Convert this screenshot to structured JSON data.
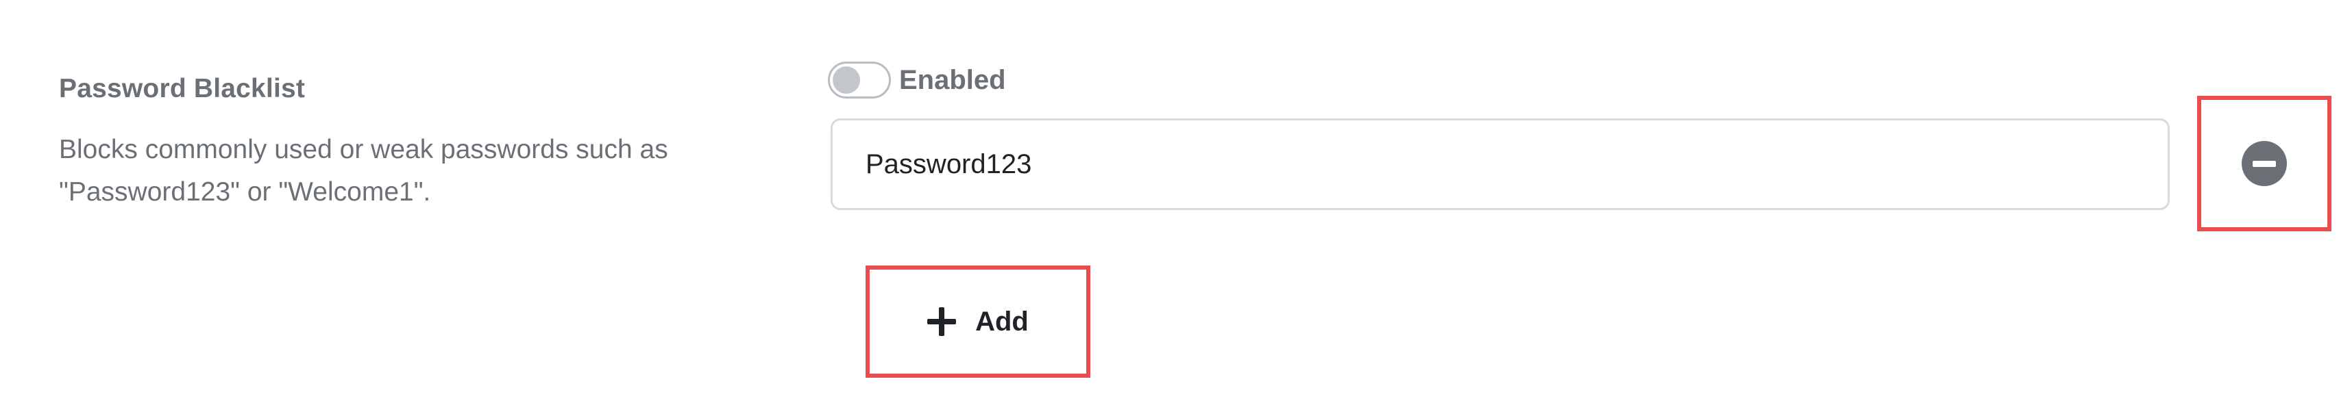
{
  "setting": {
    "title": "Password Blacklist",
    "description": "Blocks commonly used or weak passwords such as \"Password123\" or \"Welcome1\"."
  },
  "toggle": {
    "label": "Enabled",
    "state": "off"
  },
  "entries": [
    {
      "value": "Password123"
    }
  ],
  "actions": {
    "add_label": "Add"
  },
  "colors": {
    "highlight": "#e84c4f",
    "text_muted": "#6b6f76",
    "text_primary": "#1f2227"
  }
}
